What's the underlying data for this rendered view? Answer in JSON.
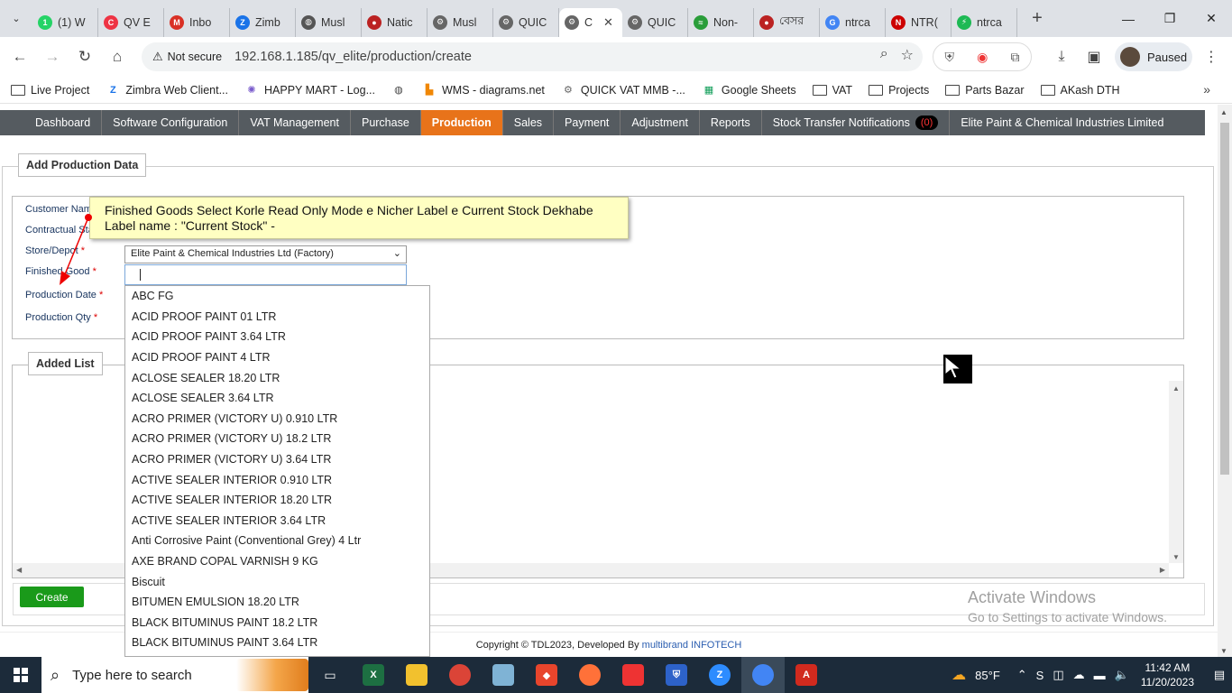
{
  "browser": {
    "tabs": [
      {
        "label": "(1) W",
        "fav": "whatsapp-icon",
        "color": "#25d366",
        "glyph": "1"
      },
      {
        "label": "QV E",
        "fav": "qv-icon",
        "color": "#e34",
        "glyph": "C"
      },
      {
        "label": "Inbo",
        "fav": "gmail-icon",
        "color": "#d93025",
        "glyph": "M"
      },
      {
        "label": "Zimb",
        "fav": "zimbra-icon",
        "color": "#1a73e8",
        "glyph": "Z"
      },
      {
        "label": "Musl",
        "fav": "globe-icon",
        "color": "#555",
        "glyph": "◍"
      },
      {
        "label": "Natic",
        "fav": "emblem-icon",
        "color": "#b22",
        "glyph": "●"
      },
      {
        "label": "Musl",
        "fav": "gear-icon",
        "color": "#666",
        "glyph": "⚙"
      },
      {
        "label": "QUIC",
        "fav": "gear-icon",
        "color": "#666",
        "glyph": "⚙"
      },
      {
        "label": "C",
        "fav": "gear-icon",
        "color": "#666",
        "glyph": "⚙"
      },
      {
        "label": "QUIC",
        "fav": "gear-icon",
        "color": "#666",
        "glyph": "⚙"
      },
      {
        "label": "Non-",
        "fav": "leaf-icon",
        "color": "#2a9d3a",
        "glyph": "≈"
      },
      {
        "label": "বেসর",
        "fav": "emblem-icon",
        "color": "#b22",
        "glyph": "●"
      },
      {
        "label": "ntrca",
        "fav": "google-icon",
        "color": "#4285f4",
        "glyph": "G"
      },
      {
        "label": "NTR(",
        "fav": "ntrca-icon",
        "color": "#c00",
        "glyph": "N"
      },
      {
        "label": "ntrca",
        "fav": "bolt-icon",
        "color": "#1db954",
        "glyph": "⚡"
      }
    ],
    "active_tab_index": 8,
    "not_secure": "Not secure",
    "url": "192.168.1.185/qv_elite/production/create",
    "paused": "Paused",
    "bookmarks": [
      {
        "label": "Live Project",
        "icon": "folder-icon"
      },
      {
        "label": "Zimbra Web Client...",
        "icon": "zimbra-icon",
        "color": "#1a73e8",
        "glyph": "Z"
      },
      {
        "label": "HAPPY MART - Log...",
        "icon": "sparkle-icon",
        "color": "#7a5ccc",
        "glyph": "✺"
      },
      {
        "label": "",
        "icon": "globe-icon",
        "color": "#444",
        "glyph": "◍"
      },
      {
        "label": "WMS - diagrams.net",
        "icon": "diagram-icon",
        "color": "#f08705",
        "glyph": "▙"
      },
      {
        "label": "QUICK VAT MMB -...",
        "icon": "gear-icon",
        "color": "#666",
        "glyph": "⚙"
      },
      {
        "label": "Google Sheets",
        "icon": "sheets-icon",
        "color": "#0f9d58",
        "glyph": "▦"
      },
      {
        "label": "VAT",
        "icon": "folder-icon"
      },
      {
        "label": "Projects",
        "icon": "folder-icon"
      },
      {
        "label": "Parts Bazar",
        "icon": "folder-icon"
      },
      {
        "label": "AKash DTH",
        "icon": "folder-icon"
      }
    ]
  },
  "nav": {
    "items": [
      "Dashboard",
      "Software Configuration",
      "VAT Management",
      "Purchase",
      "Production",
      "Sales",
      "Payment",
      "Adjustment",
      "Reports",
      "Stock Transfer Notifications"
    ],
    "active": "Production",
    "notif_count": "(0)",
    "company": "Elite Paint & Chemical Industries Limited"
  },
  "form": {
    "legend": "Add Production Data",
    "customer_label": "Customer Nam",
    "contractual_label": "Contractual Sta",
    "store_label": "Store/Depot",
    "store_value": "Elite Paint & Chemical Industries Ltd (Factory)",
    "finished_label": "Finished Good",
    "date_label": "Production Date",
    "qty_label": "Production Qty",
    "required_mark": "*"
  },
  "tooltip": {
    "line1": "Finished Goods Select Korle Read Only Mode e Nicher Label e Current Stock Dekhabe",
    "line2": "Label name : \"Current Stock\" -"
  },
  "dropdown_items": [
    "ABC FG",
    "ACID PROOF PAINT 01 LTR",
    "ACID PROOF PAINT 3.64 LTR",
    "ACID PROOF PAINT 4 LTR",
    "ACLOSE SEALER 18.20 LTR",
    "ACLOSE SEALER 3.64 LTR",
    "ACRO PRIMER (VICTORY U) 0.910 LTR",
    "ACRO PRIMER (VICTORY U) 18.2 LTR",
    "ACRO PRIMER (VICTORY U) 3.64 LTR",
    "ACTIVE SEALER INTERIOR 0.910 LTR",
    "ACTIVE SEALER INTERIOR 18.20 LTR",
    "ACTIVE SEALER INTERIOR 3.64 LTR",
    "Anti Corrosive Paint (Conventional Grey) 4 Ltr",
    "AXE BRAND COPAL VARNISH 9 KG",
    "Biscuit",
    "BITUMEN EMULSION 18.20 LTR",
    "BLACK BITUMINUS PAINT 18.2 LTR",
    "BLACK BITUMINUS PAINT 3.64 LTR"
  ],
  "list": {
    "legend": "Added List"
  },
  "create_label": "Create",
  "footer": {
    "text": "Copyright © TDL2023, Developed By",
    "brand": "multibrand INFOTECH"
  },
  "activate": {
    "line1": "Activate Windows",
    "line2": "Go to Settings to activate Windows."
  },
  "taskbar": {
    "search_placeholder": "Type here to search",
    "weather": "85°F",
    "time": "11:42 AM",
    "date": "11/20/2023"
  },
  "colors": {
    "accent": "#e8731a",
    "nav_bg": "#555b60",
    "create": "#1a9a1a"
  }
}
